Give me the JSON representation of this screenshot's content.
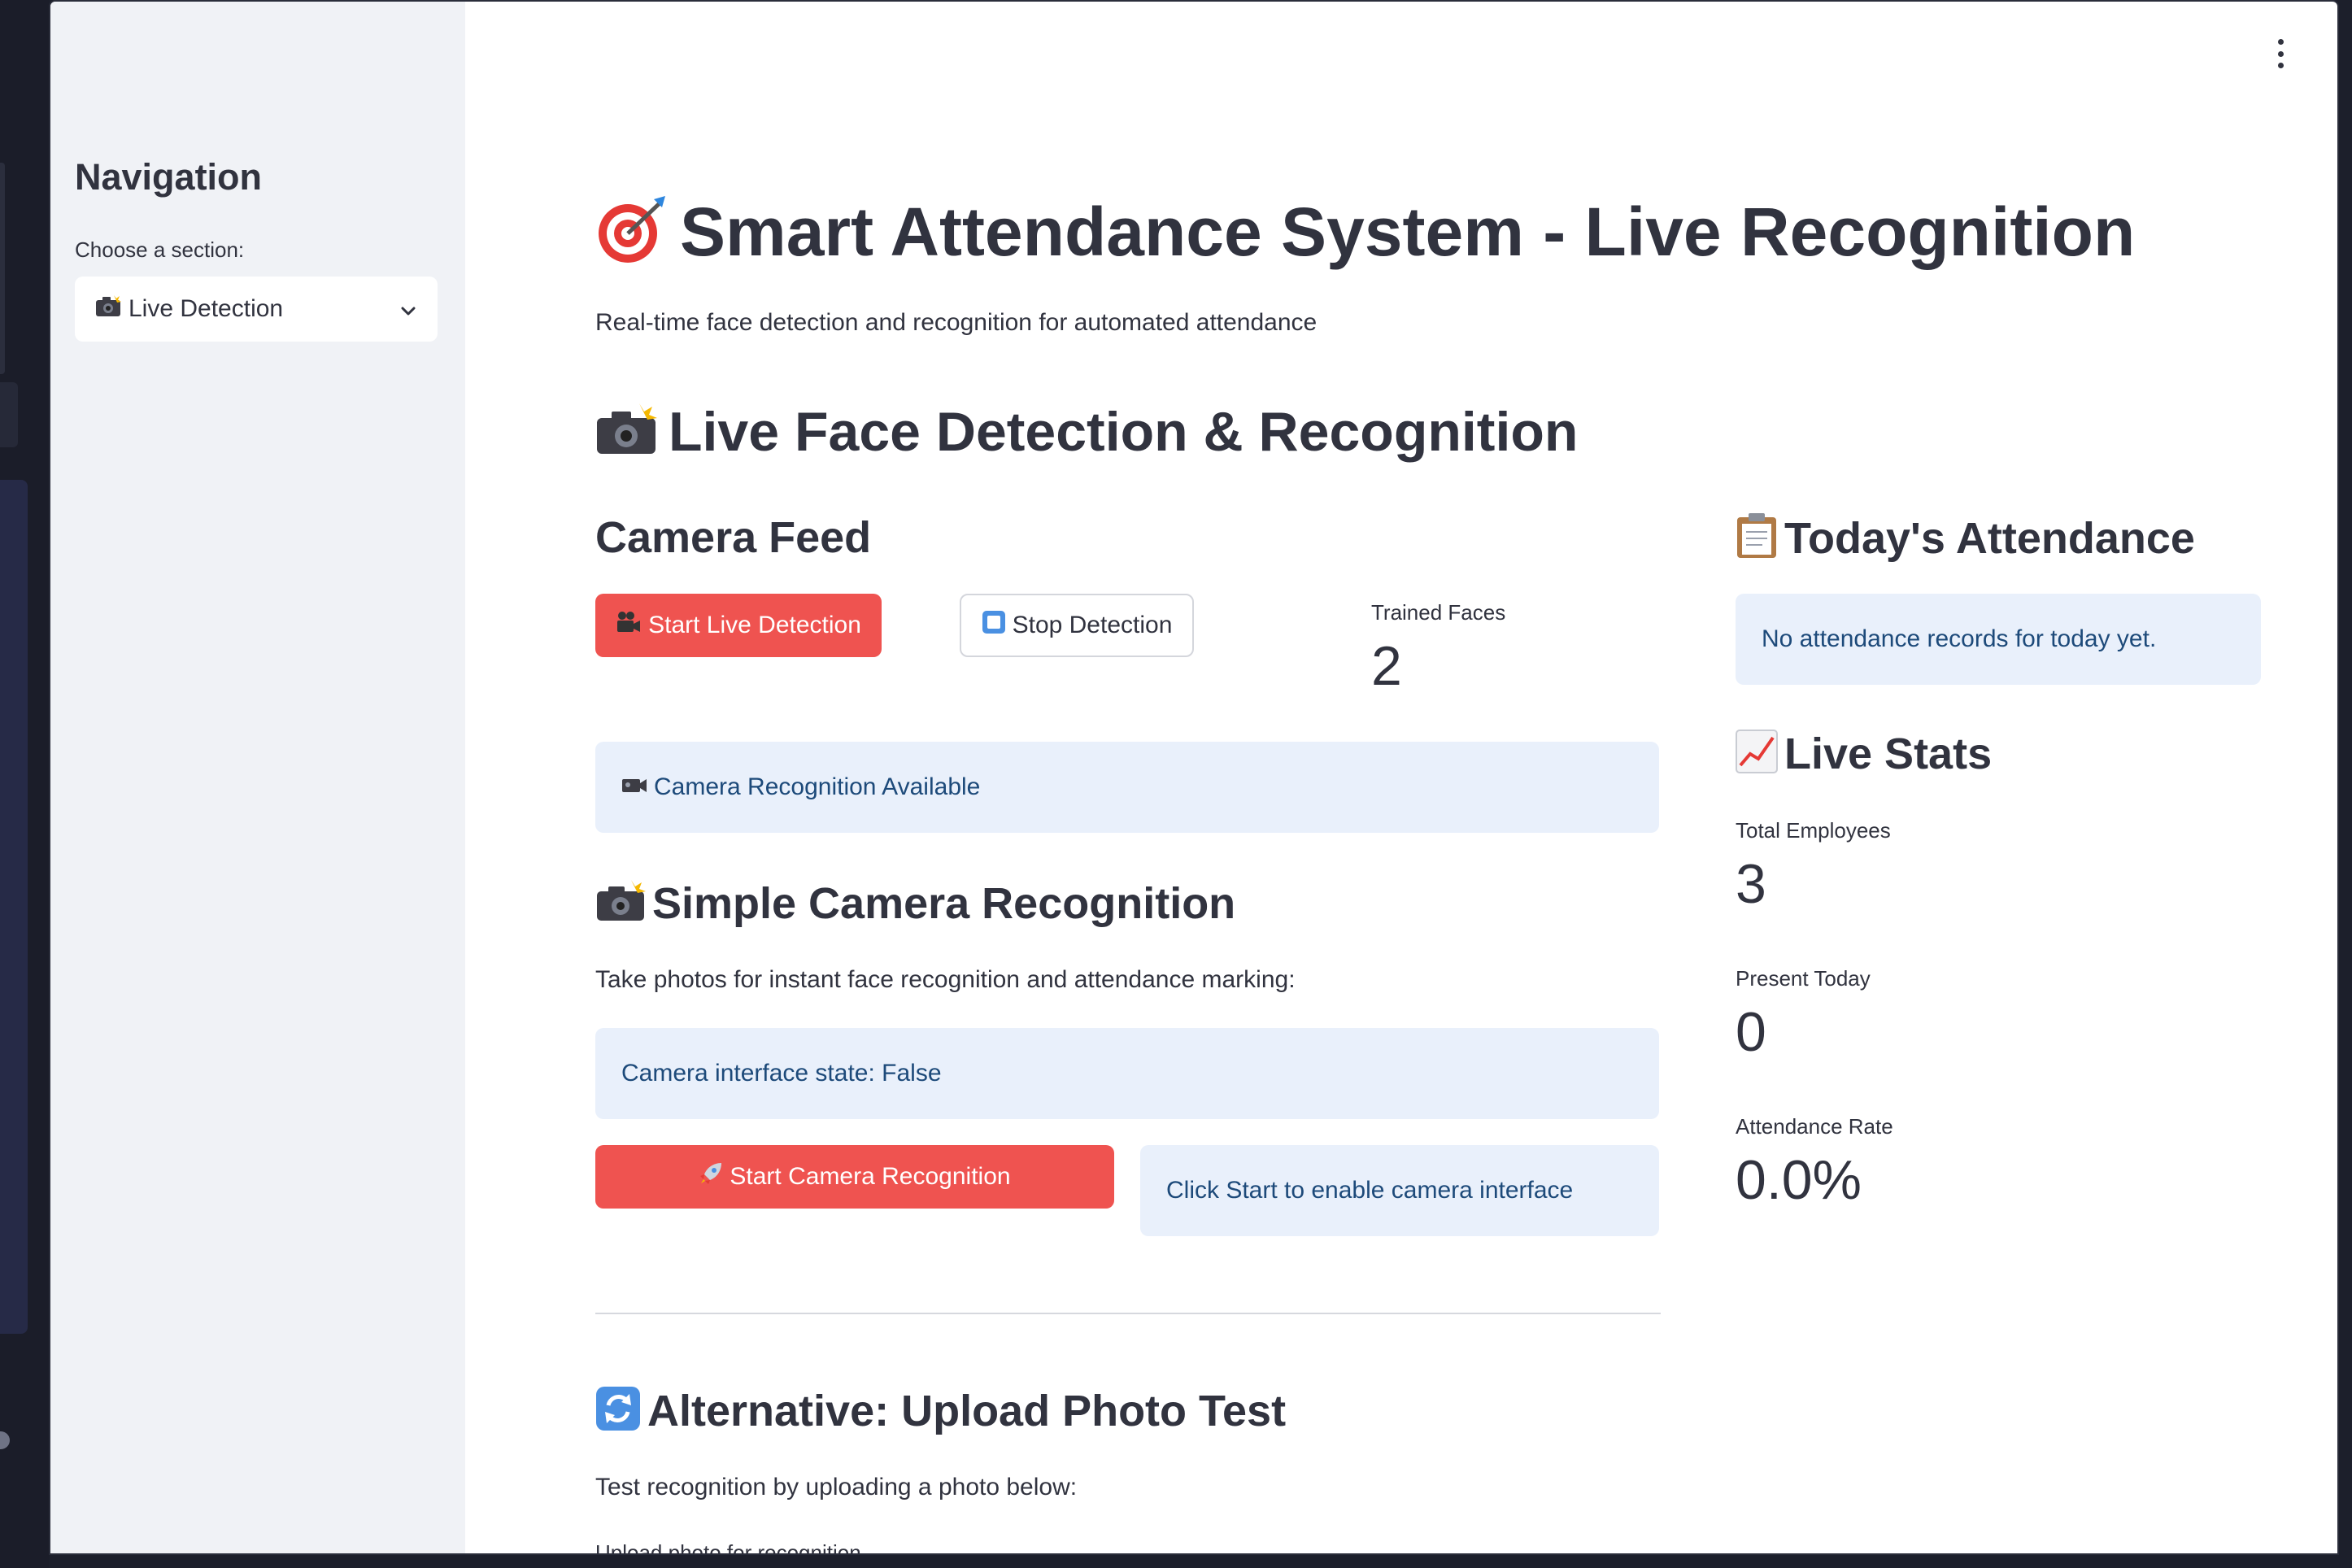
{
  "sidebar": {
    "title": "Navigation",
    "select_label": "Choose a section:",
    "select_value": "Live Detection",
    "select_icon": "camera-flash-icon"
  },
  "header": {
    "title": "Smart Attendance System - Live Recognition",
    "title_icon": "target-icon",
    "subtitle": "Real-time face detection and recognition for automated attendance"
  },
  "main": {
    "section_title": "Live Face Detection & Recognition",
    "section_icon": "camera-flash-icon",
    "camera_feed": {
      "title": "Camera Feed",
      "start_button": "Start Live Detection",
      "start_icon": "movie-camera-icon",
      "stop_button": "Stop Detection",
      "stop_icon": "stop-icon",
      "trained_faces_label": "Trained Faces",
      "trained_faces_value": "2",
      "availability_info": "Camera Recognition Available",
      "availability_icon": "video-camera-icon"
    },
    "simple_camera": {
      "title": "Simple Camera Recognition",
      "icon": "camera-flash-icon",
      "description": "Take photos for instant face recognition and attendance marking:",
      "state_info": "Camera interface state: False",
      "start_button": "Start Camera Recognition",
      "start_icon": "rocket-icon",
      "hint_info": "Click Start to enable camera interface"
    },
    "upload_test": {
      "title": "Alternative: Upload Photo Test",
      "icon": "refresh-icon",
      "description": "Test recognition by uploading a photo below:",
      "uploader_label": "Upload photo for recognition"
    }
  },
  "right_panel": {
    "attendance_title": "Today's Attendance",
    "attendance_icon": "clipboard-icon",
    "attendance_info": "No attendance records for today yet.",
    "stats_title": "Live Stats",
    "stats_icon": "chart-increasing-icon",
    "stats": [
      {
        "label": "Total Employees",
        "value": "3"
      },
      {
        "label": "Present Today",
        "value": "0"
      },
      {
        "label": "Attendance Rate",
        "value": "0.0%"
      }
    ]
  },
  "colors": {
    "primary": "#ef5350",
    "info_bg": "#e9f0fb",
    "info_text": "#1d4a7a",
    "sidebar_bg": "#f0f2f6",
    "text": "#31333f"
  }
}
